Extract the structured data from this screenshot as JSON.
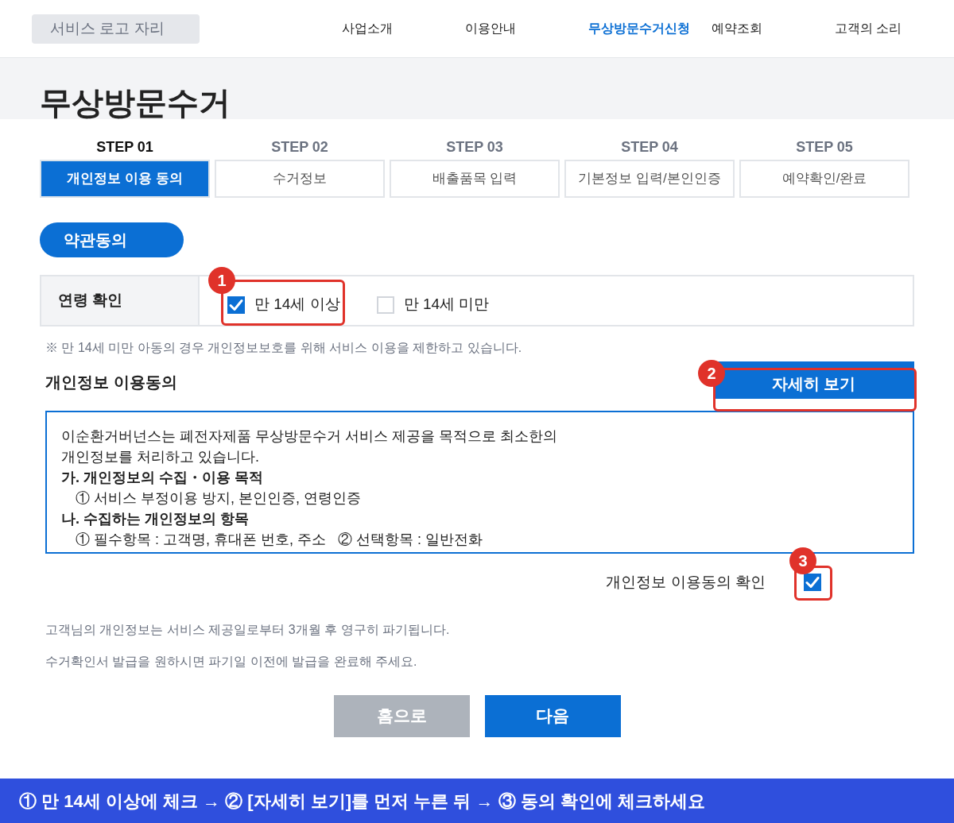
{
  "header": {
    "logo_placeholder": "서비스 로고 자리",
    "nav": [
      {
        "label": "사업소개",
        "selected": false
      },
      {
        "label": "이용안내",
        "selected": false
      },
      {
        "label": "무상방문수거신청",
        "selected": true
      },
      {
        "label": "예약조회",
        "selected": false
      },
      {
        "label": "고객의 소리",
        "selected": false
      }
    ]
  },
  "page_title": "무상방문수거",
  "steps": [
    {
      "step": "STEP 01",
      "label": "개인정보 이용 동의",
      "selected": true
    },
    {
      "step": "STEP 02",
      "label": "수거정보",
      "selected": false
    },
    {
      "step": "STEP 03",
      "label": "배출품목 입력",
      "selected": false
    },
    {
      "step": "STEP 04",
      "label": "기본정보 입력/본인인증",
      "selected": false
    },
    {
      "step": "STEP 05",
      "label": "예약확인/완료",
      "selected": false
    }
  ],
  "section_pill": "약관동의",
  "age_check": {
    "label": "연령 확인",
    "options": [
      {
        "label": "만 14세 이상",
        "checked": true,
        "callout": "1"
      },
      {
        "label": "만 14세 미만",
        "checked": false
      }
    ]
  },
  "age_note": "※ 만 14세 미만 아동의 경우 개인정보보호를 위해 서비스 이용을 제한하고 있습니다.",
  "consent": {
    "title": "개인정보 이용동의",
    "detail_button": {
      "label": "자세히 보기",
      "callout": "2"
    },
    "lines": [
      {
        "kind": "body",
        "text": "이순환거버넌스는 폐전자제품 무상방문수거 서비스 제공을 목적으로 최소한의"
      },
      {
        "kind": "body",
        "text": "개인정보를 처리하고 있습니다."
      },
      {
        "kind": "heading",
        "text": "가. 개인정보의 수집・이용 목적"
      },
      {
        "kind": "item",
        "text": "① 서비스 부정이용 방지, 본인인증, 연령인증"
      },
      {
        "kind": "heading",
        "text": "나. 수집하는 개인정보의 항목"
      },
      {
        "kind": "item",
        "text": "① 필수항목 : 고객명, 휴대폰 번호, 주소   ② 선택항목 : 일반전화"
      }
    ],
    "confirm": {
      "label": "개인정보 이용동의 확인",
      "checked": true,
      "callout": "3"
    }
  },
  "retention_notes": [
    "고객님의 개인정보는 서비스 제공일로부터 3개월 후 영구히 파기됩니다.",
    "수거확인서 발급을 원하시면 파기일 이전에 발급을 완료해 주세요."
  ],
  "buttons": [
    {
      "label": "홈으로",
      "kind": "secondary"
    },
    {
      "label": "다음",
      "kind": "primary"
    }
  ],
  "instruction_banner": "① 만 14세 이상에 체크 → ② [자세히 보기]를 먼저 누른 뒤 → ③ 동의 확인에 체크하세요"
}
